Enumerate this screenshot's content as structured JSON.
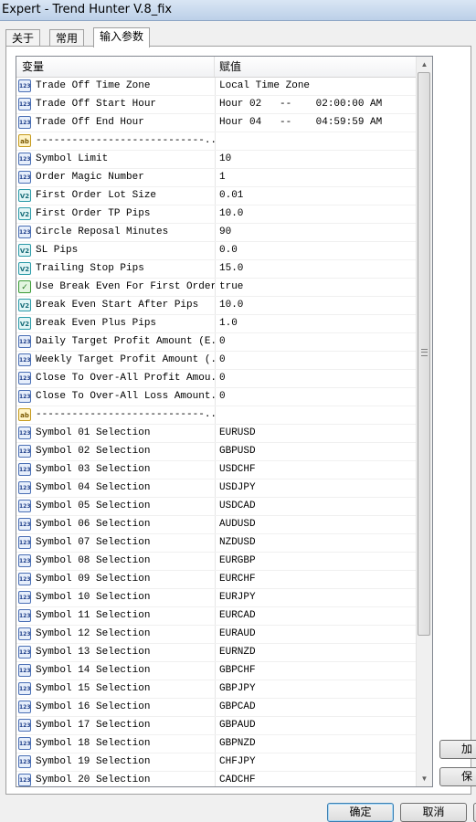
{
  "window": {
    "title": "Expert - Trend Hunter V.8_fix"
  },
  "tabs": [
    {
      "label": "关于"
    },
    {
      "label": "常用"
    },
    {
      "label": "输入参数"
    }
  ],
  "grid": {
    "col_variable": "变量",
    "col_value": "赋值",
    "rows": [
      {
        "icon": "int-type-icon",
        "name": "Trade Off Time Zone",
        "value": "Local Time Zone"
      },
      {
        "icon": "int-type-icon",
        "name": "Trade Off Start Hour",
        "value": "Hour 02   --    02:00:00 AM"
      },
      {
        "icon": "int-type-icon",
        "name": "Trade Off End Hour",
        "value": "Hour 04   --    04:59:59 AM"
      },
      {
        "icon": "string-type-icon",
        "name": "----------------------------...",
        "value": ""
      },
      {
        "icon": "int-type-icon",
        "name": "Symbol Limit",
        "value": "10"
      },
      {
        "icon": "int-type-icon",
        "name": "Order Magic Number",
        "value": "1"
      },
      {
        "icon": "double-type-icon",
        "name": "First Order Lot Size",
        "value": "0.01"
      },
      {
        "icon": "double-type-icon",
        "name": "First Order TP Pips",
        "value": "10.0"
      },
      {
        "icon": "int-type-icon",
        "name": "Circle Reposal Minutes",
        "value": "90"
      },
      {
        "icon": "double-type-icon",
        "name": "SL Pips",
        "value": "0.0"
      },
      {
        "icon": "double-type-icon",
        "name": "Trailing Stop Pips",
        "value": "15.0"
      },
      {
        "icon": "bool-type-icon",
        "name": "Use Break Even For First Order",
        "value": "true"
      },
      {
        "icon": "double-type-icon",
        "name": "Break Even Start After Pips",
        "value": "10.0"
      },
      {
        "icon": "double-type-icon",
        "name": "Break Even Plus Pips",
        "value": "1.0"
      },
      {
        "icon": "int-type-icon",
        "name": "Daily Target Profit Amount (E...",
        "value": "0"
      },
      {
        "icon": "int-type-icon",
        "name": "Weekly Target Profit Amount (...",
        "value": "0"
      },
      {
        "icon": "int-type-icon",
        "name": "Close To Over-All Profit Amou...",
        "value": "0"
      },
      {
        "icon": "int-type-icon",
        "name": "Close To Over-All Loss Amount...",
        "value": "0"
      },
      {
        "icon": "string-type-icon",
        "name": "----------------------------...",
        "value": ""
      },
      {
        "icon": "int-type-icon",
        "name": "Symbol 01 Selection",
        "value": "EURUSD"
      },
      {
        "icon": "int-type-icon",
        "name": "Symbol 02 Selection",
        "value": "GBPUSD"
      },
      {
        "icon": "int-type-icon",
        "name": "Symbol 03 Selection",
        "value": "USDCHF"
      },
      {
        "icon": "int-type-icon",
        "name": "Symbol 04 Selection",
        "value": "USDJPY"
      },
      {
        "icon": "int-type-icon",
        "name": "Symbol 05 Selection",
        "value": "USDCAD"
      },
      {
        "icon": "int-type-icon",
        "name": "Symbol 06 Selection",
        "value": "AUDUSD"
      },
      {
        "icon": "int-type-icon",
        "name": "Symbol 07 Selection",
        "value": "NZDUSD"
      },
      {
        "icon": "int-type-icon",
        "name": "Symbol 08 Selection",
        "value": "EURGBP"
      },
      {
        "icon": "int-type-icon",
        "name": "Symbol 09 Selection",
        "value": "EURCHF"
      },
      {
        "icon": "int-type-icon",
        "name": "Symbol 10 Selection",
        "value": "EURJPY"
      },
      {
        "icon": "int-type-icon",
        "name": "Symbol 11 Selection",
        "value": "EURCAD"
      },
      {
        "icon": "int-type-icon",
        "name": "Symbol 12 Selection",
        "value": "EURAUD"
      },
      {
        "icon": "int-type-icon",
        "name": "Symbol 13 Selection",
        "value": "EURNZD"
      },
      {
        "icon": "int-type-icon",
        "name": "Symbol 14 Selection",
        "value": "GBPCHF"
      },
      {
        "icon": "int-type-icon",
        "name": "Symbol 15 Selection",
        "value": "GBPJPY"
      },
      {
        "icon": "int-type-icon",
        "name": "Symbol 16 Selection",
        "value": "GBPCAD"
      },
      {
        "icon": "int-type-icon",
        "name": "Symbol 17 Selection",
        "value": "GBPAUD"
      },
      {
        "icon": "int-type-icon",
        "name": "Symbol 18 Selection",
        "value": "GBPNZD"
      },
      {
        "icon": "int-type-icon",
        "name": "Symbol 19 Selection",
        "value": "CHFJPY"
      },
      {
        "icon": "int-type-icon",
        "name": "Symbol 20 Selection",
        "value": "CADCHF"
      }
    ]
  },
  "side_buttons": {
    "load_label": "加",
    "save_label": "保"
  },
  "footer": {
    "ok_label": "确定",
    "cancel_label": "取消"
  }
}
